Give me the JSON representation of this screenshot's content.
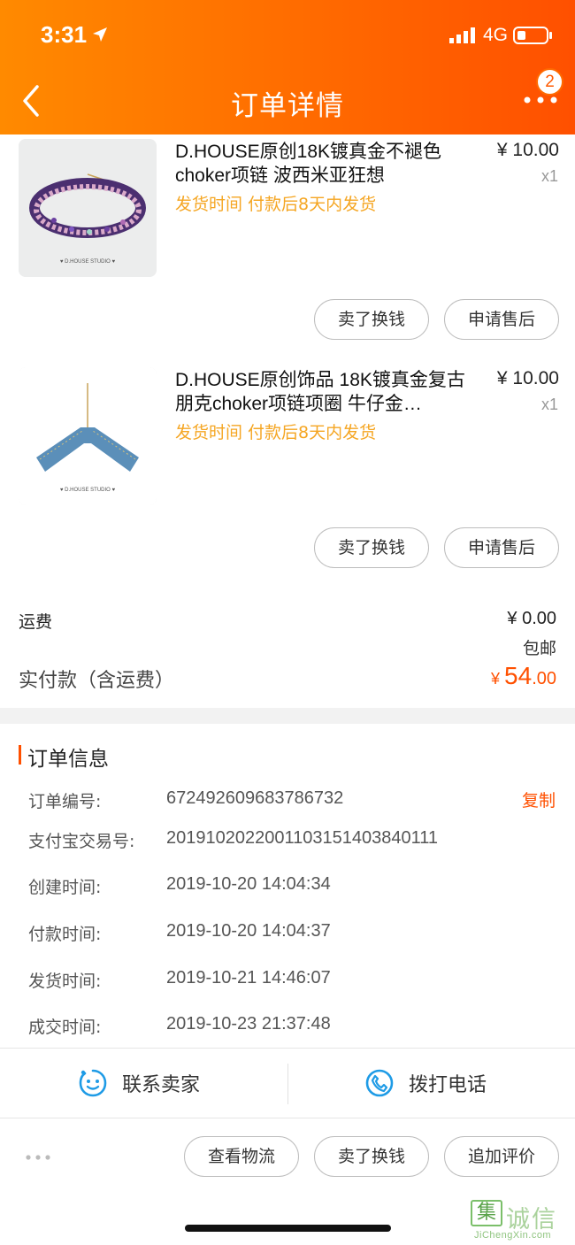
{
  "status_bar": {
    "time": "3:31",
    "network": "4G"
  },
  "header": {
    "title": "订单详情",
    "badge_count": "2"
  },
  "products": [
    {
      "title": "D.HOUSE原创18K镀真金不褪色choker项链 波西米亚狂想",
      "price": "¥ 10.00",
      "qty": "x1",
      "delivery_note": "发货时间  付款后8天内发货",
      "image_caption": "♥ D.HOUSE STUDIO ♥",
      "buttons": [
        "卖了换钱",
        "申请售后"
      ]
    },
    {
      "title": "D.HOUSE原创饰品 18K镀真金复古朋克choker项链项圈 牛仔金…",
      "price": "¥ 10.00",
      "qty": "x1",
      "delivery_note": "发货时间  付款后8天内发货",
      "image_caption": "♥ D.HOUSE STUDIO ♥",
      "buttons": [
        "卖了换钱",
        "申请售后"
      ]
    }
  ],
  "summary": {
    "shipping_label": "运费",
    "shipping_value": "¥ 0.00",
    "free_shipping": "包邮",
    "paid_label": "实付款（含运费）",
    "paid_currency": "¥ ",
    "paid_int": "54",
    "paid_dec": ".00"
  },
  "order_info": {
    "section_title": "订单信息",
    "copy_label": "复制",
    "rows": [
      {
        "label": "订单编号:",
        "value": "672492609683786732"
      },
      {
        "label": "支付宝交易号:",
        "value": "2019102022001103151403840111"
      },
      {
        "label": "创建时间:",
        "value": "2019-10-20 14:04:34"
      },
      {
        "label": "付款时间:",
        "value": "2019-10-20 14:04:37"
      },
      {
        "label": "发货时间:",
        "value": "2019-10-21 14:46:07"
      },
      {
        "label": "成交时间:",
        "value": "2019-10-23 21:37:48"
      }
    ]
  },
  "contact": {
    "seller_label": "联系卖家",
    "phone_label": "拨打电话"
  },
  "bottom_actions": [
    "查看物流",
    "卖了换钱",
    "追加评价"
  ],
  "watermark": {
    "mark": "集",
    "text": "诚信",
    "url": "JiChengXin.com"
  },
  "colors": {
    "accent": "#ff5000",
    "header_start": "#ff8a00",
    "delivery_note": "#f5a623"
  }
}
